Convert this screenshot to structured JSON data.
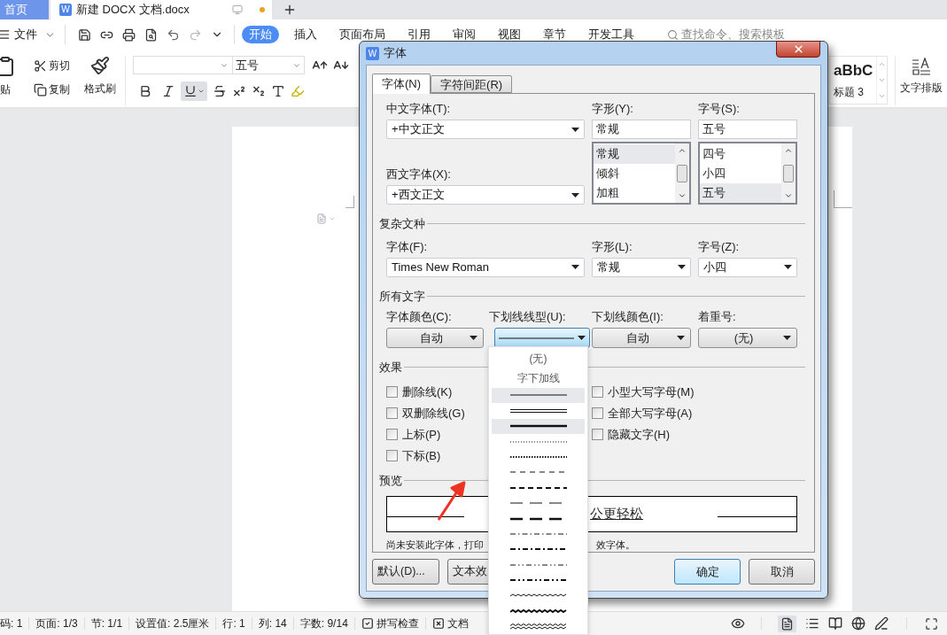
{
  "tabs": [
    {
      "label": "首页",
      "kind": "home",
      "selected": false
    },
    {
      "label": "新建 DOCX 文档.docx",
      "kind": "doc",
      "selected": true,
      "unsaved": true,
      "icon_letter": "W"
    }
  ],
  "menu": {
    "file": "文件",
    "ribbon": [
      {
        "label": "开始",
        "selected": true
      },
      {
        "label": "插入",
        "selected": false
      },
      {
        "label": "页面布局",
        "selected": false
      },
      {
        "label": "引用",
        "selected": false
      },
      {
        "label": "审阅",
        "selected": false
      },
      {
        "label": "视图",
        "selected": false
      },
      {
        "label": "章节",
        "selected": false
      },
      {
        "label": "开发工具",
        "selected": false
      }
    ],
    "search_placeholder": "查找命令、搜索模板"
  },
  "toolbar": {
    "paste": "贴",
    "cut": "剪切",
    "copy": "复制",
    "format_painter": "格式刷",
    "font_size": "五号",
    "underline_on": true,
    "style_sample": "aBbC",
    "style_name": "标题 3",
    "text_layout": "文字排版"
  },
  "dialog": {
    "icon_letter": "W",
    "title": "字体",
    "tabs": [
      {
        "label": "字体(N)",
        "selected": true
      },
      {
        "label": "字符间距(R)",
        "selected": false
      }
    ],
    "chinese_font": {
      "label": "中文字体(T):",
      "value": "+中文正文"
    },
    "style": {
      "label": "字形(Y):",
      "value": "常规",
      "options": [
        {
          "label": "常规",
          "selected": true
        },
        {
          "label": "倾斜",
          "selected": false
        },
        {
          "label": "加粗",
          "selected": false
        }
      ]
    },
    "size": {
      "label": "字号(S):",
      "value": "五号",
      "options": [
        {
          "label": "四号",
          "selected": false
        },
        {
          "label": "小四",
          "selected": false
        },
        {
          "label": "五号",
          "selected": true
        }
      ]
    },
    "western_font": {
      "label": "西文字体(X):",
      "value": "+西文正文"
    },
    "complex": {
      "heading": "复杂文种",
      "font": {
        "label": "字体(F):",
        "value": "Times New Roman"
      },
      "style": {
        "label": "字形(L):",
        "value": "常规"
      },
      "size": {
        "label": "字号(Z):",
        "value": "小四"
      }
    },
    "all_text": {
      "heading": "所有文字",
      "font_color": {
        "label": "字体颜色(C):",
        "value": "自动"
      },
      "underline_type": {
        "label": "下划线线型(U):",
        "kind": "solid",
        "open": true
      },
      "underline_color": {
        "label": "下划线颜色(I):",
        "value": "自动"
      },
      "emphasis": {
        "label": "着重号:",
        "value": "(无)"
      }
    },
    "effects": {
      "heading": "效果",
      "column_1": [
        {
          "label": "删除线(K)",
          "checked": false
        },
        {
          "label": "双删除线(G)",
          "checked": false
        },
        {
          "label": "上标(P)",
          "checked": false
        },
        {
          "label": "下标(B)",
          "checked": false
        }
      ],
      "column_2": [
        {
          "label": "小型大写字母(M)",
          "checked": false
        },
        {
          "label": "全部大写字母(A)",
          "checked": false
        },
        {
          "label": "隐藏文字(H)",
          "checked": false
        }
      ]
    },
    "preview": {
      "heading": "预览",
      "sample": "公更轻松",
      "note_start": "尚未安装此字体，打印",
      "note_end": "效字体。"
    },
    "buttons_left": [
      {
        "label": "默认(D)...",
        "default": false
      },
      {
        "label": "文本效",
        "default": false
      }
    ],
    "buttons_right": [
      {
        "label": "确定",
        "default": true
      },
      {
        "label": "取消",
        "default": false
      }
    ]
  },
  "underline_menu": [
    {
      "kind": "text",
      "label": "(无)",
      "highlighted": false
    },
    {
      "kind": "text",
      "label": "字下加线",
      "highlighted": false
    },
    {
      "kind": "solid",
      "highlighted": true
    },
    {
      "kind": "double",
      "highlighted": false
    },
    {
      "kind": "thick",
      "highlighted": true
    },
    {
      "kind": "dotted",
      "highlighted": false
    },
    {
      "kind": "dotted_heavy",
      "highlighted": false
    },
    {
      "kind": "dash",
      "highlighted": false
    },
    {
      "kind": "dash_heavy",
      "highlighted": false
    },
    {
      "kind": "long_dash",
      "highlighted": false
    },
    {
      "kind": "long_dash_heavy",
      "highlighted": false
    },
    {
      "kind": "dash_dot",
      "highlighted": false
    },
    {
      "kind": "dash_dot_heavy",
      "highlighted": false
    },
    {
      "kind": "dash_dot_dot",
      "highlighted": false
    },
    {
      "kind": "dash_dot_dot_heavy",
      "highlighted": false
    },
    {
      "kind": "wave",
      "highlighted": false
    },
    {
      "kind": "wave_heavy",
      "highlighted": false
    },
    {
      "kind": "wave_double",
      "highlighted": false
    }
  ],
  "status_bar": {
    "items": [
      "码: 1",
      "页面: 1/3",
      "节: 1/1",
      "设置值: 2.5厘米",
      "行: 1",
      "列: 14",
      "字数: 9/14"
    ],
    "spell_check": "拼写检查",
    "doc_check": "文档"
  }
}
